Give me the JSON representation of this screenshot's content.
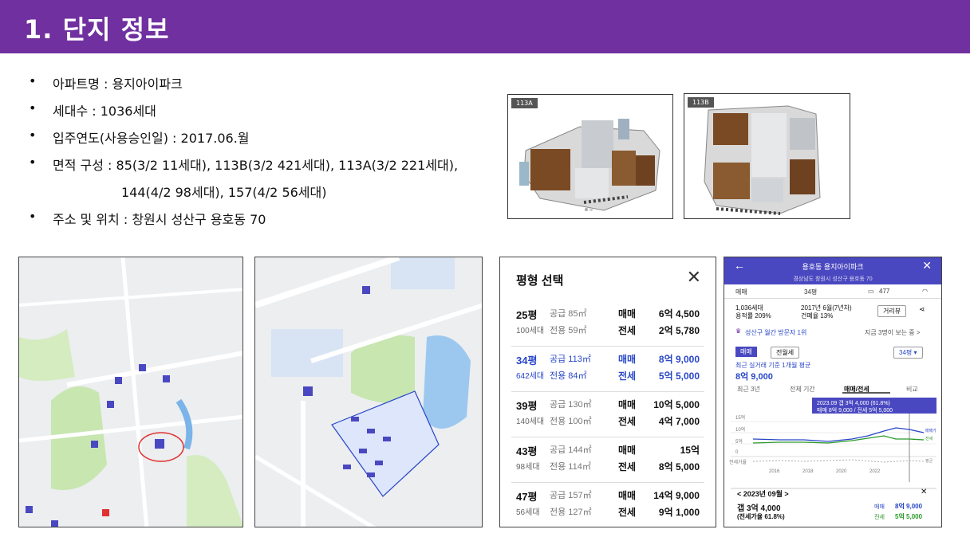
{
  "header": {
    "title": "1. 단지 정보"
  },
  "bullets": [
    {
      "dot": "•",
      "text": "아파트명 : 용지아이파크"
    },
    {
      "dot": "•",
      "text": "세대수 : 1036세대"
    },
    {
      "dot": "•",
      "text": "입주연도(사용승인일) : 2017.06.월"
    },
    {
      "dot": "•",
      "text": "면적 구성 : 85(3/2 11세대), 113B(3/2  421세대), 113A(3/2 221세대),"
    },
    {
      "dot": "",
      "text": "144(4/2 98세대), 157(4/2 56세대)"
    },
    {
      "dot": "•",
      "text": "주소  및 위치 : 창원시 성산구 용호동 70"
    }
  ],
  "floorplans": [
    {
      "tag": "113A"
    },
    {
      "tag": "113B"
    }
  ],
  "pyeong_panel": {
    "title": "평형 선택",
    "close": "✕",
    "rows": [
      {
        "pyeong": "25평",
        "households": "100세대",
        "supply": "공급 85㎡",
        "exclusive": "전용 59㎡",
        "sale_label": "매매",
        "sale": "6억 4,500",
        "jeonse_label": "전세",
        "jeonse": "2억 5,780",
        "selected": false
      },
      {
        "pyeong": "34평",
        "households": "642세대",
        "supply": "공급 113㎡",
        "exclusive": "전용 84㎡",
        "sale_label": "매매",
        "sale": "8억 9,000",
        "jeonse_label": "전세",
        "jeonse": "5억 5,000",
        "selected": true
      },
      {
        "pyeong": "39평",
        "households": "140세대",
        "supply": "공급 130㎡",
        "exclusive": "전용 100㎡",
        "sale_label": "매매",
        "sale": "10억 5,000",
        "jeonse_label": "전세",
        "jeonse": "4억 7,000",
        "selected": false
      },
      {
        "pyeong": "43평",
        "households": "98세대",
        "supply": "공급 144㎡",
        "exclusive": "전용 114㎡",
        "sale_label": "매매",
        "sale": "15억",
        "jeonse_label": "전세",
        "jeonse": "8억 5,000",
        "selected": false
      },
      {
        "pyeong": "47평",
        "households": "56세대",
        "supply": "공급 157㎡",
        "exclusive": "전용 127㎡",
        "sale_label": "매매",
        "sale": "14억 9,000",
        "jeonse_label": "전세",
        "jeonse": "9억 1,000",
        "selected": false
      }
    ]
  },
  "app": {
    "title": "용호동 용지아이파크",
    "address": "경상남도 창원시 성산구 용호동 70",
    "tab_trade": "매매",
    "tab_size": "34평",
    "tab_comments": "477",
    "info_households": "1,036세대",
    "info_far": "용적률 209%",
    "info_year": "2017년 6월(7년차)",
    "info_bcr": "건폐율 13%",
    "street_view": "거리뷰",
    "rank": "성산구 월간 방문자 1위",
    "viewers": "지금 3명이 보는 중 >",
    "chip_sale": "매매",
    "chip_jeonse": "전월세",
    "size_select": "34평 ▾",
    "recent_avg_label": "최근 실거래 기준 1개월 평균",
    "recent_avg": "8억 9,000",
    "period_3y": "최근 3년",
    "period_all": "전체 기간",
    "period_sj": "매매/전세",
    "period_cmp": "비교",
    "tooltip_line1": "2023.09  갭 3억 4,000 (61.8%)",
    "tooltip_line2": "매매 8억 9,000 / 전세 5억 5,000",
    "y15": "15억",
    "y10": "10억",
    "y5": "5억",
    "y0": "0",
    "ratio_label": "전세가율",
    "legend_sale": "매매가",
    "legend_jeonse": "전세",
    "legend_avg": "평균",
    "x2016": "2016",
    "x2018": "2018",
    "x2020": "2020",
    "x2022": "2022",
    "month": "<  2023년 09월  >",
    "gap": "갭 3억 4,000",
    "gap_ratio": "(전세가율 61.8%)",
    "sale_label": "매매",
    "sale_value": "8억 9,000",
    "jeonse_label": "전세",
    "jeonse_value": "5억 5,000",
    "colors": {
      "primary": "#4a48c0",
      "sale": "#2846c8",
      "jeonse": "#2a9a2a"
    }
  },
  "chart_data": {
    "type": "line",
    "x": [
      "2016",
      "2018",
      "2020",
      "2022"
    ],
    "series": [],
    "yticks": [
      "0",
      "5억",
      "10억",
      "15억"
    ]
  }
}
